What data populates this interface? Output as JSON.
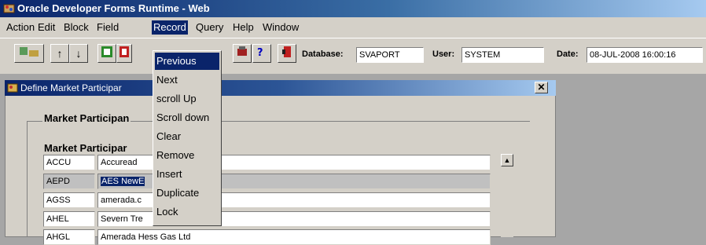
{
  "window": {
    "title": "Oracle Developer Forms Runtime - Web"
  },
  "menu": {
    "items": [
      {
        "label": "Action"
      },
      {
        "label": "Edit"
      },
      {
        "label": "Block"
      },
      {
        "label": "Field"
      },
      {
        "label": "Record"
      },
      {
        "label": "Query"
      },
      {
        "label": "Help"
      },
      {
        "label": "Window"
      }
    ],
    "active": "Record"
  },
  "record_menu": {
    "items": [
      {
        "label": "Previous"
      },
      {
        "label": "Next"
      },
      {
        "label": "scroll Up"
      },
      {
        "label": "Scroll down"
      },
      {
        "label": "Clear"
      },
      {
        "label": "Remove"
      },
      {
        "label": "Insert"
      },
      {
        "label": "Duplicate"
      },
      {
        "label": "Lock"
      }
    ]
  },
  "toolbar": {
    "database_label": "Database:",
    "database_value": "SVAPORT",
    "user_label": "User:",
    "user_value": "SYSTEM",
    "date_label": "Date:",
    "date_value": "08-JUL-2008 16:00:16"
  },
  "form": {
    "title": "Define Market Participar",
    "frame_title": "Market Participan",
    "section_title": "Market Participar",
    "rows": [
      {
        "code": "ACCU",
        "name": "Accuread"
      },
      {
        "code": "AEPD",
        "name": "AES NewE"
      },
      {
        "code": "AGSS",
        "name": "amerada.c"
      },
      {
        "code": "AHEL",
        "name": "Severn Tre"
      },
      {
        "code": "AHGL",
        "name": "Amerada Hess Gas Ltd"
      }
    ]
  },
  "colors": {
    "accent": "#0a246a",
    "chrome": "#d4d0c8",
    "background": "#a6a6a6"
  }
}
